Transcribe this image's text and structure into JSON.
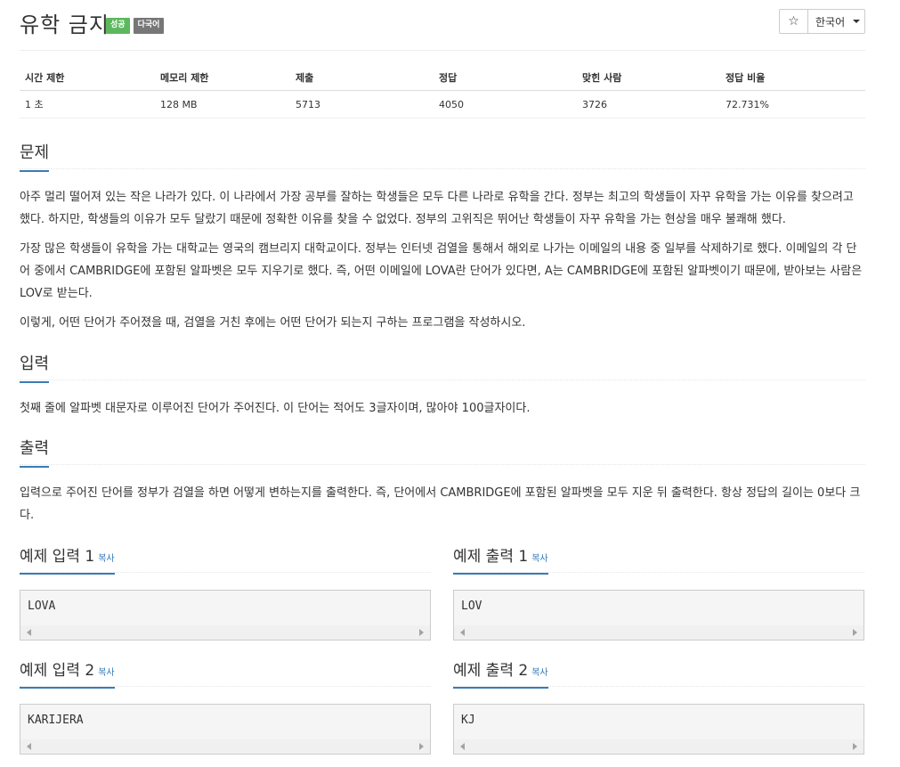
{
  "problem": {
    "title": "유학 금지",
    "badges": [
      "성공",
      "다국어"
    ],
    "star_icon": "☆",
    "language": "한국어"
  },
  "stats": {
    "headers": [
      "시간 제한",
      "메모리 제한",
      "제출",
      "정답",
      "맞힌 사람",
      "정답 비율"
    ],
    "values": [
      "1 초",
      "128 MB",
      "5713",
      "4050",
      "3726",
      "72.731%"
    ]
  },
  "sections": {
    "description": {
      "heading": "문제",
      "paragraphs": [
        "아주 멀리 떨어져 있는 작은 나라가 있다. 이 나라에서 가장 공부를 잘하는 학생들은 모두 다른 나라로 유학을 간다. 정부는 최고의 학생들이 자꾸 유학을 가는 이유를 찾으려고 했다. 하지만, 학생들의 이유가 모두 달랐기 때문에 정확한 이유를 찾을 수 없었다. 정부의 고위직은 뛰어난 학생들이 자꾸 유학을 가는 현상을 매우 불쾌해 했다.",
        "가장 많은 학생들이 유학을 가는 대학교는 영국의 캠브리지 대학교이다. 정부는 인터넷 검열을 통해서 해외로 나가는 이메일의 내용 중 일부를 삭제하기로 했다. 이메일의 각 단어 중에서 CAMBRIDGE에 포함된 알파벳은 모두 지우기로 했다. 즉, 어떤 이메일에 LOVA란 단어가 있다면, A는 CAMBRIDGE에 포함된 알파벳이기 때문에, 받아보는 사람은 LOV로 받는다.",
        "이렇게, 어떤 단어가 주어졌을 때, 검열을 거친 후에는 어떤 단어가 되는지 구하는 프로그램을 작성하시오."
      ]
    },
    "input": {
      "heading": "입력",
      "text": "첫째 줄에 알파벳 대문자로 이루어진 단어가 주어진다. 이 단어는 적어도 3글자이며, 많아야 100글자이다."
    },
    "output": {
      "heading": "출력",
      "text": "입력으로 주어진 단어를 정부가 검열을 하면 어떻게 변하는지를 출력한다. 즉, 단어에서 CAMBRIDGE에 포함된 알파벳을 모두 지운 뒤 출력한다. 항상 정답의 길이는 0보다 크다."
    }
  },
  "samples": [
    {
      "input_heading": "예제 입력 1",
      "input": "LOVA",
      "output_heading": "예제 출력 1",
      "output": "LOV"
    },
    {
      "input_heading": "예제 입력 2",
      "input": "KARIJERA",
      "output_heading": "예제 출력 2",
      "output": "KJ"
    }
  ],
  "copy_label": "복사"
}
